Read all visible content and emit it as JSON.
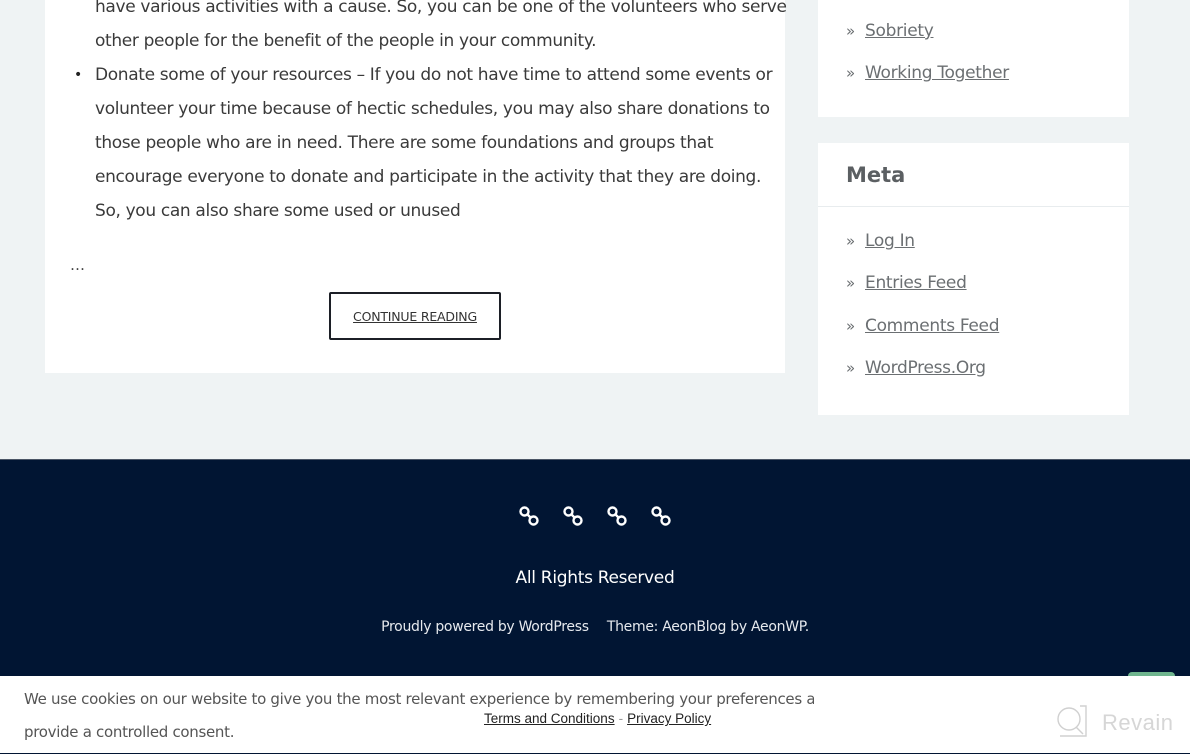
{
  "post": {
    "lines": [
      "have various activities with a cause. So, you can be one of the volunteers who serve",
      "other people for the benefit of the people in your community."
    ],
    "bullet_item_lines": [
      "Donate some of your resources – If you do not have time to attend some events or",
      "volunteer your time because of hectic schedules, you may also share donations to",
      "those people who are in need. There are some foundations and groups that",
      "encourage everyone to donate and participate in the activity that they are doing.",
      "So, you can also share some used or unused"
    ],
    "bullet_glyph": "•",
    "ellipsis": "…",
    "continue_label": "CONTINUE READING"
  },
  "sidebar": {
    "categories": {
      "items": [
        {
          "label": "Sobriety"
        },
        {
          "label": "Working Together"
        }
      ]
    },
    "meta": {
      "title": "Meta",
      "items": [
        {
          "label": "Log In"
        },
        {
          "label": "Entries Feed"
        },
        {
          "label": "Comments Feed"
        },
        {
          "label": "WordPress.Org"
        }
      ]
    },
    "item_prefix": "»"
  },
  "footer": {
    "social_icons": [
      "link-icon",
      "link-icon",
      "link-icon",
      "link-icon"
    ],
    "rights": "All Rights Reserved",
    "powered_by": "Proudly powered by WordPress",
    "theme_credit": "Theme: AeonBlog by AeonWP."
  },
  "cookie": {
    "line1": "We use cookies on our website to give you the most relevant experience by remembering your preferences and repeat",
    "line2": "provide a controlled consent.",
    "terms_label": "Terms and Conditions",
    "separator": "-",
    "privacy_label": "Privacy Policy"
  },
  "watermark": {
    "label": "Revain"
  },
  "colors": {
    "page_bg": "#eff3f4",
    "footer_bg": "#011533",
    "accent_green": "#6fb58e"
  }
}
